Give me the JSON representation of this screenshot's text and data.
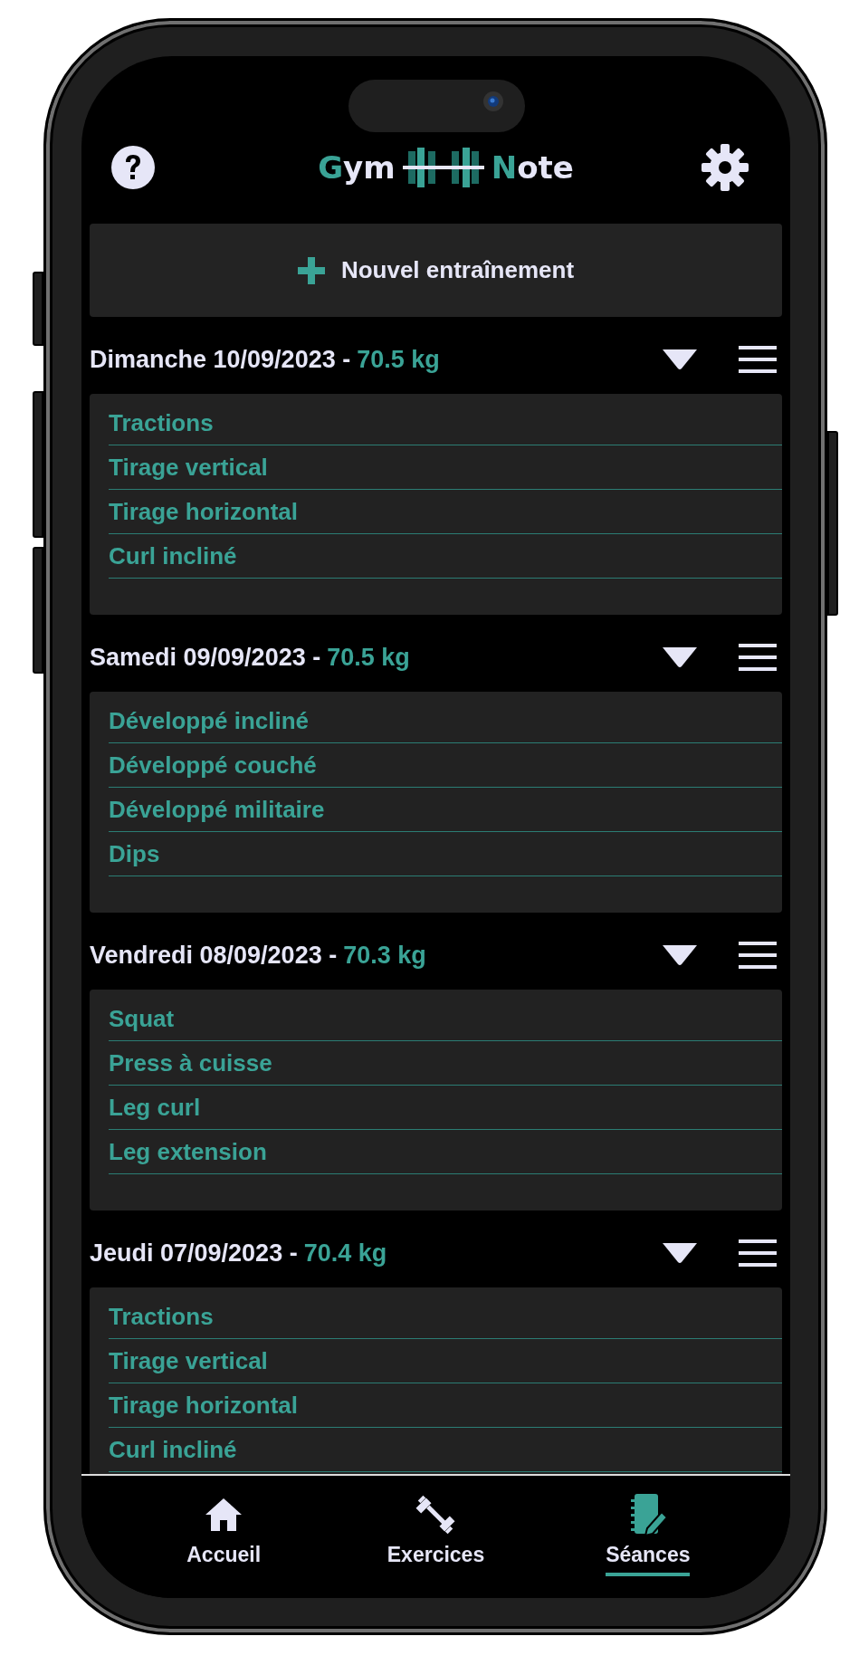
{
  "header": {
    "logo_left": "Gym",
    "logo_right": "Note"
  },
  "new_workout_button": {
    "label": "Nouvel entraînement"
  },
  "sessions": [
    {
      "date": "Dimanche 10/09/2023 -",
      "weight": "70.5 kg",
      "expanded": true,
      "exercises": [
        "Tractions",
        "Tirage vertical",
        "Tirage horizontal",
        "Curl incliné"
      ]
    },
    {
      "date": "Samedi 09/09/2023 -",
      "weight": "70.5 kg",
      "expanded": true,
      "exercises": [
        "Développé incliné",
        "Développé couché",
        "Développé militaire",
        "Dips"
      ]
    },
    {
      "date": "Vendredi 08/09/2023 -",
      "weight": "70.3 kg",
      "expanded": true,
      "exercises": [
        "Squat",
        "Press à cuisse",
        "Leg curl",
        "Leg extension"
      ]
    },
    {
      "date": "Jeudi 07/09/2023 -",
      "weight": "70.4 kg",
      "expanded": true,
      "exercises": [
        "Tractions",
        "Tirage vertical",
        "Tirage horizontal",
        "Curl incliné"
      ]
    }
  ],
  "nav": [
    {
      "kind": "home",
      "label": "Accueil",
      "selected": false
    },
    {
      "kind": "exercises",
      "label": "Exercices",
      "selected": false
    },
    {
      "kind": "sessions",
      "label": "Séances",
      "selected": true
    }
  ]
}
